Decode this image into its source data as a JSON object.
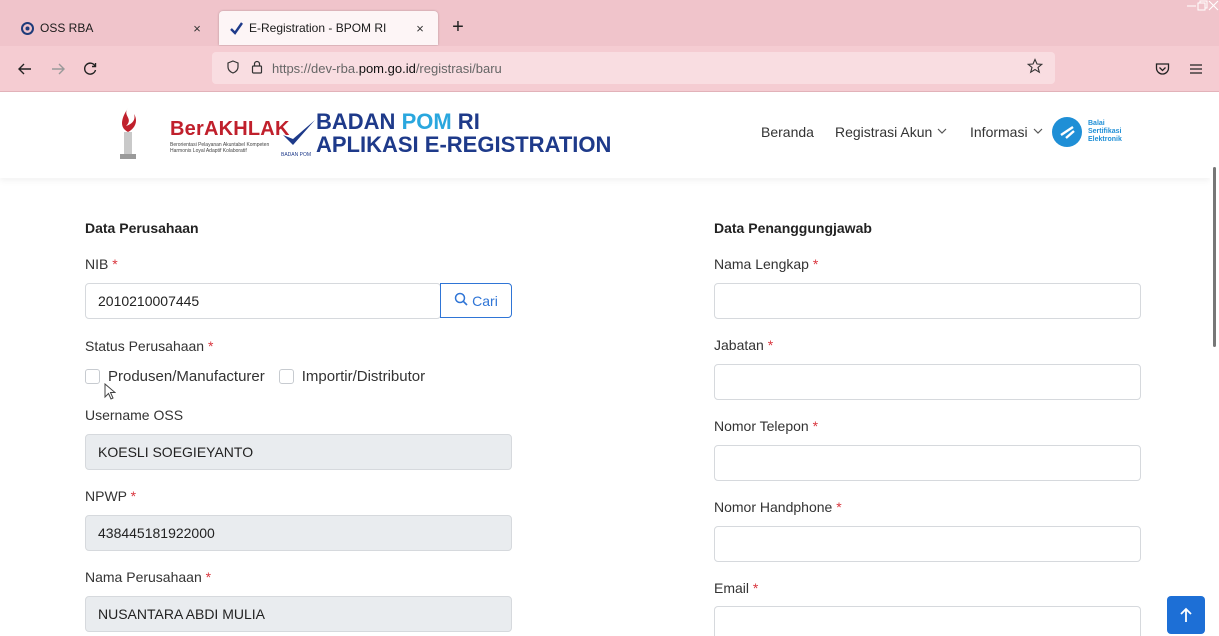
{
  "browser": {
    "tabs": [
      {
        "title": "OSS RBA",
        "icon": "oss-icon",
        "active": false
      },
      {
        "title": "E-Registration - BPOM RI",
        "icon": "checkmark-icon",
        "active": true
      }
    ],
    "close_glyph": "×",
    "new_tab_glyph": "+",
    "url": {
      "prefix": "https://dev-rba.",
      "domain": "pom.go.id",
      "path": "/registrasi/baru"
    }
  },
  "header": {
    "berakhlak": {
      "name": "BerAKHLAK",
      "tagline": "Berorientasi Pelayanan Akuntabel Kompeten Harmonis Loyal Adaptif Kolaboratif"
    },
    "pom": {
      "line1_a": "BADAN ",
      "line1_b": "POM",
      "line1_c": " RI",
      "line2": "APLIKASI E-REGISTRATION",
      "small": "BADAN POM"
    },
    "menu": {
      "beranda": "Beranda",
      "registrasi": "Registrasi Akun",
      "informasi": "Informasi"
    },
    "bsre": {
      "l1": "Balai",
      "l2": "Sertifikasi",
      "l3": "Elektronik"
    }
  },
  "company": {
    "title": "Data Perusahaan",
    "nib": {
      "label": "NIB",
      "value": "2010210007445",
      "button": "Cari"
    },
    "status": {
      "label": "Status Perusahaan",
      "opt1": "Produsen/Manufacturer",
      "opt2": "Importir/Distributor"
    },
    "username": {
      "label": "Username OSS",
      "value": "KOESLI SOEGIEYANTO"
    },
    "npwp": {
      "label": "NPWP",
      "value": "438445181922000"
    },
    "nama": {
      "label": "Nama Perusahaan",
      "value": "NUSANTARA ABDI MULIA"
    }
  },
  "responsible": {
    "title": "Data Penanggungjawab",
    "nama": {
      "label": "Nama Lengkap"
    },
    "jabatan": {
      "label": "Jabatan"
    },
    "telepon": {
      "label": "Nomor Telepon"
    },
    "handphone": {
      "label": "Nomor Handphone"
    },
    "email": {
      "label": "Email"
    }
  },
  "required_mark": "*",
  "colors": {
    "tabbar": "#f0c4cb",
    "navy": "#1e3a8a",
    "primary": "#2f75d6",
    "required": "#d9363e"
  }
}
